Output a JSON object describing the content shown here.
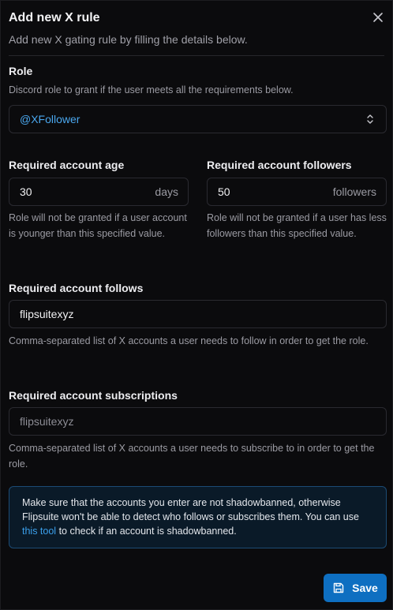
{
  "dialog": {
    "title": "Add new X rule",
    "subtitle": "Add new X gating rule by filling the details below.",
    "close_icon": "close-icon"
  },
  "role": {
    "label": "Role",
    "help": "Discord role to grant if the user meets all the requirements below.",
    "selected": "@XFollower",
    "icon": "chevron-up-down-icon"
  },
  "account_age": {
    "label": "Required account age",
    "value": "30",
    "unit": "days",
    "help": "Role will not be granted if a user account is younger than this specified value."
  },
  "account_followers": {
    "label": "Required account followers",
    "value": "50",
    "unit": "followers",
    "help": "Role will not be granted if a user has less followers than this specified value."
  },
  "account_follows": {
    "label": "Required account follows",
    "value": "flipsuitexyz",
    "help": "Comma-separated list of X accounts a user needs to follow in order to get the role."
  },
  "account_subscriptions": {
    "label": "Required account subscriptions",
    "placeholder": "flipsuitexyz",
    "help": "Comma-separated list of X accounts a user needs to subscribe to in order to get the role."
  },
  "notice": {
    "text_before": "Make sure that the accounts you enter are not shadowbanned, otherwise Flipsuite won't be able to detect who follows or subscribes them. You can use ",
    "link": "this tool",
    "text_after": " to check if an account is shadowbanned."
  },
  "footer": {
    "save_label": "Save",
    "save_icon": "save-icon"
  },
  "colors": {
    "background": "#0b0b0d",
    "accent": "#0e6fc1",
    "link": "#3ba0ec",
    "notice_bg": "#0a1a28",
    "notice_border": "#1c4b74"
  }
}
